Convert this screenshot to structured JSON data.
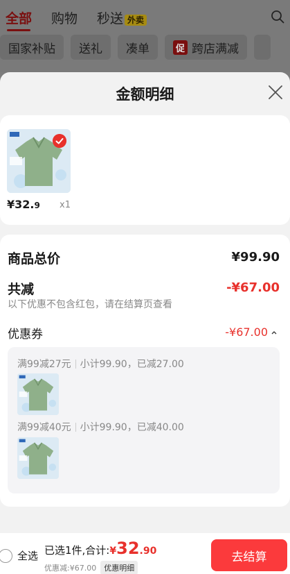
{
  "background": {
    "tabs": [
      {
        "label": "全部",
        "active": true
      },
      {
        "label": "购物",
        "active": false
      },
      {
        "label": "秒送",
        "active": false,
        "badge": "外卖"
      }
    ],
    "chips": [
      {
        "label": "国家补贴"
      },
      {
        "label": "送礼"
      },
      {
        "label": "凑单"
      },
      {
        "label": "跨店满减",
        "tag": "促"
      }
    ]
  },
  "sheet": {
    "title": "金额明细"
  },
  "product": {
    "price_main": "¥32.",
    "price_decimal": "9",
    "quantity": "x1"
  },
  "detail": {
    "total_label": "商品总价",
    "total_value": "¥99.90",
    "discount_label": "共减",
    "discount_value": "-¥67.00",
    "hint": "以下优惠不包含红包，请在结算页查看",
    "coupon_label": "优惠券",
    "coupon_value": "-¥67.00",
    "rules": [
      {
        "rule": "满99减27元",
        "detail": "小计99.90，已减27.00"
      },
      {
        "rule": "满99减40元",
        "detail": "小计99.90，已减40.00"
      }
    ]
  },
  "bottom_bar": {
    "select_all_label": "全选",
    "summary_prefix": "已选1件,合计:",
    "summary_currency": "¥",
    "summary_int": "32",
    "summary_decimal": ".90",
    "discount_text": "优惠减:¥67.00",
    "discount_button": "优惠明细",
    "checkout_label": "去结算"
  },
  "colors": {
    "accent": "#e8312c",
    "checkout": "#fb3a3c",
    "product_green": "#8fb08a"
  }
}
